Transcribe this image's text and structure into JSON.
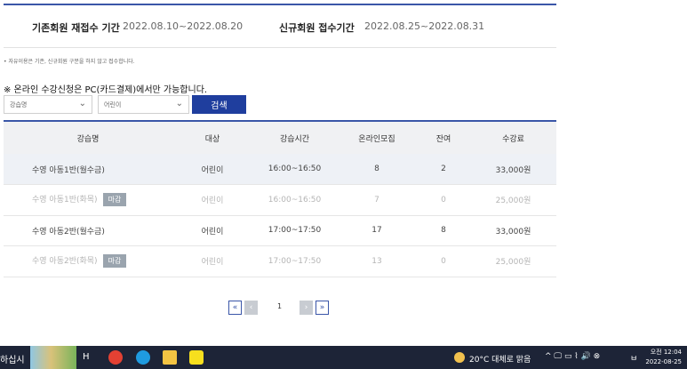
{
  "periods": {
    "existing_label": "기존회원 재접수 기간",
    "existing_value": "2022.08.10~2022.08.20",
    "new_label": "신규회원 접수기간",
    "new_value": "2022.08.25~2022.08.31"
  },
  "note": "• 자유이용은 기존, 신규회원 구분을 하지 않고 접수합니다.",
  "online_note": "※ 온라인 수강신청은 PC(카드결제)에서만 가능합니다.",
  "filters": {
    "lesson_select": "강습명",
    "target_select": "어린이",
    "search_label": "검색"
  },
  "table": {
    "headers": [
      "강습명",
      "대상",
      "강습시간",
      "온라인모집",
      "잔여",
      "수강료"
    ],
    "rows": [
      {
        "name": "수영 아동1반(월수금)",
        "badge": "",
        "target": "어린이",
        "time": "16:00~16:50",
        "online": "8",
        "remaining": "2",
        "fee": "33,000원"
      },
      {
        "name": "수영 아동1반(화목)",
        "badge": "마감",
        "target": "어린이",
        "time": "16:00~16:50",
        "online": "7",
        "remaining": "0",
        "fee": "25,000원"
      },
      {
        "name": "수영 아동2반(월수금)",
        "badge": "",
        "target": "어린이",
        "time": "17:00~17:50",
        "online": "17",
        "remaining": "8",
        "fee": "33,000원"
      },
      {
        "name": "수영 아동2반(화목)",
        "badge": "마감",
        "target": "어린이",
        "time": "17:00~17:50",
        "online": "13",
        "remaining": "0",
        "fee": "25,000원"
      }
    ]
  },
  "pagination": {
    "first": "«",
    "prev": "‹",
    "current": "1",
    "next": "›",
    "last": "»"
  },
  "taskbar": {
    "search_text": "하십시",
    "widget_text": "H",
    "weather": "20°C 대체로 맑음",
    "tray_symbols": "^ 🖵 ▭ ⌇ 🔊 ⊗",
    "ime": "ㅂ",
    "time": "오전 12:04",
    "date": "2022-08-25"
  },
  "colors": {
    "accent": "#1f3e9e",
    "header_border": "#3a56a8",
    "closed_badge": "#9aa4ae",
    "taskbar": "#1d2437"
  }
}
